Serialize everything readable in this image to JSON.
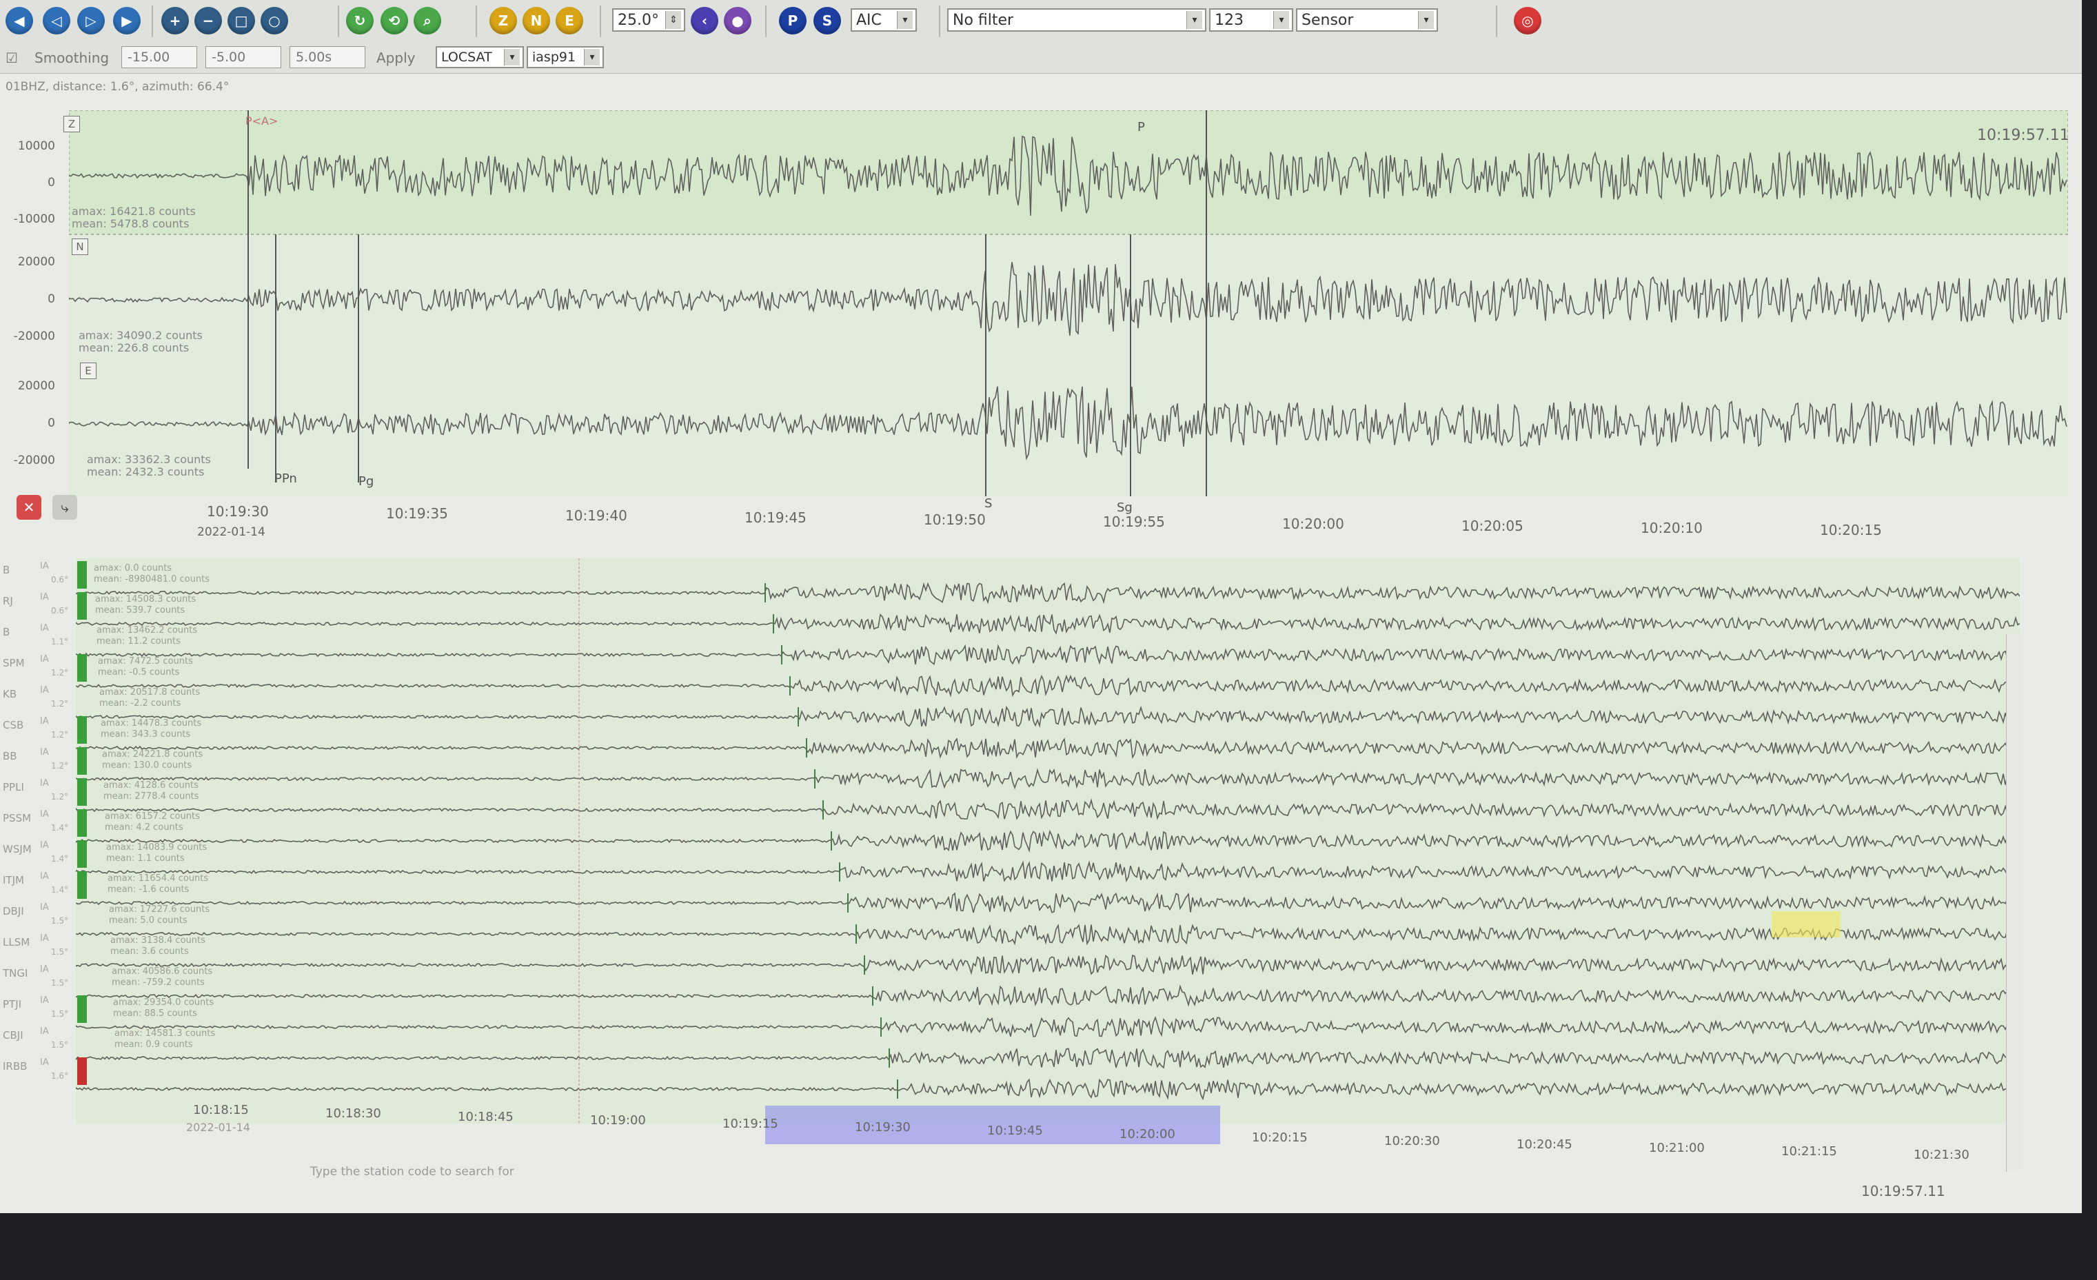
{
  "toolbar": {
    "zoom_value": "25.0°",
    "picker_method": "AIC",
    "filter": "No filter",
    "components": "123",
    "unit": "Sensor",
    "comp_buttons": [
      "Z",
      "N",
      "E"
    ],
    "phase_buttons": [
      "P",
      "S"
    ]
  },
  "toolbar2": {
    "smoothing_label": "Smoothing",
    "val1": "-15.00",
    "val2": "-5.00",
    "val3": "5.00s",
    "apply_label": "Apply",
    "locator": "LOCSAT",
    "model": "iasp91"
  },
  "info_line": "01BHZ, distance: 1.6°, azimuth: 66.4°",
  "upper": {
    "time_readout": "10:19:57.11",
    "traces": [
      {
        "comp": "Z",
        "amax": "amax: 16421.8 counts",
        "mean": "mean: 5478.8 counts",
        "yticks": [
          "10000",
          "0",
          "-10000"
        ]
      },
      {
        "comp": "N",
        "amax": "amax: 34090.2 counts",
        "mean": "mean: 226.8 counts",
        "yticks": [
          "20000",
          "0",
          "-20000"
        ]
      },
      {
        "comp": "E",
        "amax": "amax: 33362.3 counts",
        "mean": "mean: 2432.3 counts",
        "yticks": [
          "20000",
          "0",
          "-20000"
        ]
      }
    ],
    "picks": {
      "p_auto": "P<A>",
      "p": "P",
      "ppn": "PPn",
      "pg": "Pg",
      "s": "S",
      "sg": "Sg"
    },
    "date": "2022-01-14",
    "xticks": [
      "10:19:30",
      "10:19:35",
      "10:19:40",
      "10:19:45",
      "10:19:50",
      "10:19:55",
      "10:20:00",
      "10:20:05",
      "10:20:10",
      "10:20:15"
    ]
  },
  "lower": {
    "stations": [
      {
        "name": "B",
        "chan": "IA",
        "dist": "0.6°",
        "amax": "amax: 0.0 counts",
        "mean": "mean: -8980481.0 counts",
        "status": "#3a9e3a"
      },
      {
        "name": "RJ",
        "chan": "IA",
        "dist": "0.6°",
        "amax": "amax: 14508.3 counts",
        "mean": "mean: 539.7 counts",
        "status": "#3a9e3a"
      },
      {
        "name": "B",
        "chan": "IA",
        "dist": "1.1°",
        "amax": "amax: 13462.2 counts",
        "mean": "mean: 11.2 counts",
        "status": ""
      },
      {
        "name": "SPM",
        "chan": "IA",
        "dist": "1.2°",
        "amax": "amax: 7472.5 counts",
        "mean": "mean: -0.5 counts",
        "status": "#3a9e3a"
      },
      {
        "name": "KB",
        "chan": "IA",
        "dist": "1.2°",
        "amax": "amax: 20517.8 counts",
        "mean": "mean: -2.2 counts",
        "status": ""
      },
      {
        "name": "CSB",
        "chan": "IA",
        "dist": "1.2°",
        "amax": "amax: 14478.3 counts",
        "mean": "mean: 343.3 counts",
        "status": "#3a9e3a"
      },
      {
        "name": "BB",
        "chan": "IA",
        "dist": "1.2°",
        "amax": "amax: 24221.8 counts",
        "mean": "mean: 130.0 counts",
        "status": "#3a9e3a"
      },
      {
        "name": "PPLI",
        "chan": "IA",
        "dist": "1.2°",
        "amax": "amax: 4128.6 counts",
        "mean": "mean: 2778.4 counts",
        "status": "#3a9e3a"
      },
      {
        "name": "PSSM",
        "chan": "IA",
        "dist": "1.4°",
        "amax": "amax: 6157.2 counts",
        "mean": "mean: 4.2 counts",
        "status": "#3a9e3a"
      },
      {
        "name": "WSJM",
        "chan": "IA",
        "dist": "1.4°",
        "amax": "amax: 14083.9 counts",
        "mean": "mean: 1.1 counts",
        "status": "#3a9e3a"
      },
      {
        "name": "ITJM",
        "chan": "IA",
        "dist": "1.4°",
        "amax": "amax: 11654.4 counts",
        "mean": "mean: -1.6 counts",
        "status": "#3a9e3a"
      },
      {
        "name": "DBJI",
        "chan": "IA",
        "dist": "1.5°",
        "amax": "amax: 17227.6 counts",
        "mean": "mean: 5.0 counts",
        "status": ""
      },
      {
        "name": "LLSM",
        "chan": "IA",
        "dist": "1.5°",
        "amax": "amax: 3138.4 counts",
        "mean": "mean: 3.6 counts",
        "status": ""
      },
      {
        "name": "TNGI",
        "chan": "IA",
        "dist": "1.5°",
        "amax": "amax: 40586.6 counts",
        "mean": "mean: -759.2 counts",
        "status": ""
      },
      {
        "name": "PTJI",
        "chan": "IA",
        "dist": "1.5°",
        "amax": "amax: 29354.0 counts",
        "mean": "mean: 88.5 counts",
        "status": "#3a9e3a"
      },
      {
        "name": "CBJI",
        "chan": "IA",
        "dist": "1.5°",
        "amax": "amax: 14581.3 counts",
        "mean": "mean: 0.9 counts",
        "status": ""
      },
      {
        "name": "IRBB",
        "chan": "IA",
        "dist": "1.6°",
        "amax": "",
        "mean": "",
        "status": "#c53030"
      }
    ],
    "date": "2022-01-14",
    "xticks": [
      "10:18:15",
      "10:18:30",
      "10:18:45",
      "10:19:00",
      "10:19:15",
      "10:19:30",
      "10:19:45",
      "10:20:00",
      "10:20:15",
      "10:20:30",
      "10:20:45",
      "10:21:00",
      "10:21:15",
      "10:21:30"
    ],
    "time_readout": "10:19:57.11",
    "search_hint": "Type the station code to search for"
  },
  "colors": {
    "plot_bg": "#e2ecdc",
    "trace": "#5d5f5b",
    "selection": "#7a7af0",
    "highlight": "#f0e65a",
    "ok": "#3a9e3a",
    "bad": "#c53030"
  }
}
